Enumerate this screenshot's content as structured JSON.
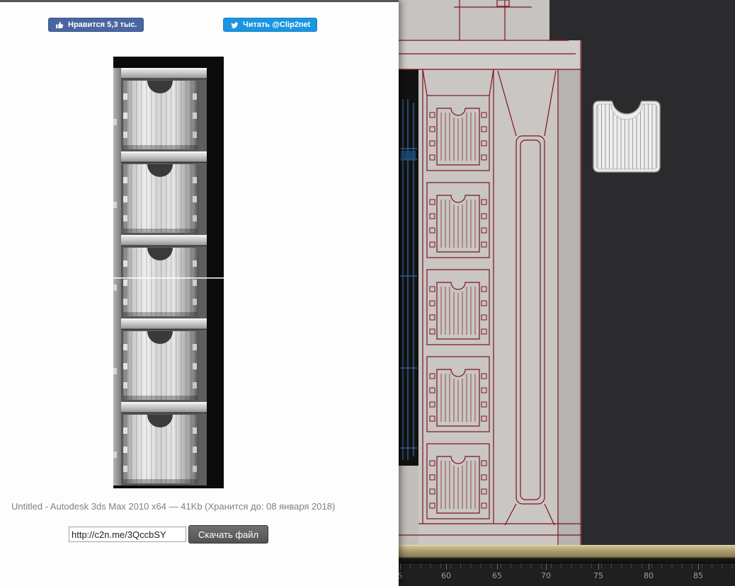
{
  "social": {
    "facebook_like": "Нравится 5,3 тыс.",
    "twitter_follow": "Читать @Clip2net"
  },
  "screenshot": {
    "caption": "Untitled - Autodesk 3ds Max 2010 x64 — 41Kb (Хранится до: 08 января 2018)",
    "share_url": "http://c2n.me/3QccbSY",
    "download_label": "Скачать файл"
  },
  "viewport": {
    "timeline_labels": [
      "5",
      "60",
      "65",
      "70",
      "75",
      "80",
      "85"
    ],
    "colors": {
      "viewport_background": "#2b2b2d",
      "model_fill": "#c9c6c3",
      "wireframe_red": "#7c1420",
      "wireframe_blue": "#3f7fc4",
      "ground_bar": "#a5966b",
      "facebook_blue": "#4a66a0",
      "twitter_blue": "#1b95e0",
      "download_button_gray": "#5c5c5c"
    }
  }
}
